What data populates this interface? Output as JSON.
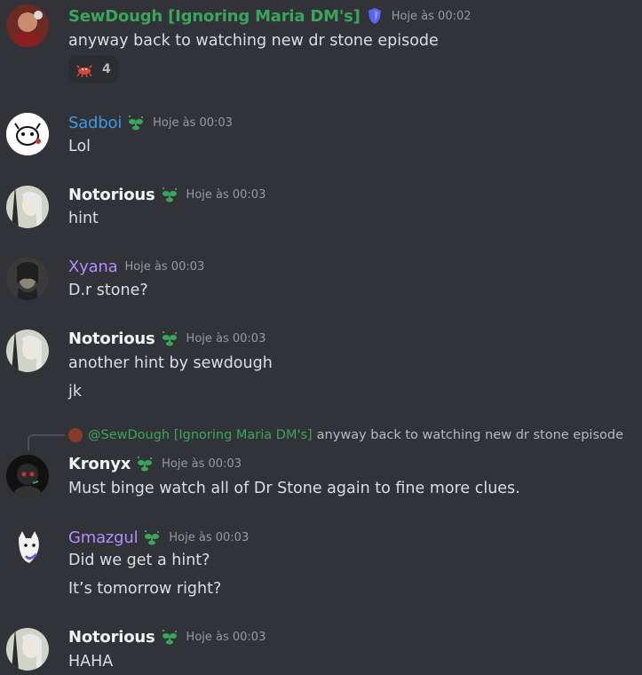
{
  "colors": {
    "background": "#313338",
    "green_name": "#3ba55c",
    "blue_name": "#3e98e8",
    "white_name": "#f2f3f5",
    "purple_name": "#b48cff",
    "timestamp": "#949ba4"
  },
  "messages": [
    {
      "author": "SewDough [Ignoring Maria DM's]",
      "badge_icon": "shield-icon",
      "timestamp": "Hoje às 00:02",
      "lines": [
        "anyway back to watching new dr stone episode"
      ],
      "reaction": {
        "emoji_icon": "crab-emoji-icon",
        "count": "4"
      }
    },
    {
      "author": "Sadboi",
      "badge_icon": "sprout-icon",
      "timestamp": "Hoje às 00:03",
      "lines": [
        "Lol"
      ]
    },
    {
      "author": "Notorious",
      "badge_icon": "sprout-icon",
      "timestamp": "Hoje às 00:03",
      "lines": [
        "hint"
      ]
    },
    {
      "author": "Xyana",
      "timestamp": "Hoje às 00:03",
      "lines": [
        "D.r stone?"
      ]
    },
    {
      "author": "Notorious",
      "badge_icon": "sprout-icon",
      "timestamp": "Hoje às 00:03",
      "lines": [
        "another hint by sewdough",
        "jk"
      ]
    },
    {
      "reply_to": {
        "mention": "@SewDough [Ignoring Maria DM's]",
        "text": "anyway back to watching new dr stone episode"
      },
      "author": "Kronyx",
      "badge_icon": "sprout-icon",
      "timestamp": "Hoje às 00:03",
      "lines": [
        "Must binge watch all of Dr Stone again to fine more clues."
      ]
    },
    {
      "author": "Gmazgul",
      "badge_icon": "sprout-icon",
      "timestamp": "Hoje às 00:03",
      "lines": [
        "Did we get a hint?",
        "It’s tomorrow right?"
      ]
    },
    {
      "author": "Notorious",
      "badge_icon": "sprout-icon",
      "timestamp": "Hoje às 00:03",
      "lines": [
        "HAHA"
      ]
    }
  ]
}
